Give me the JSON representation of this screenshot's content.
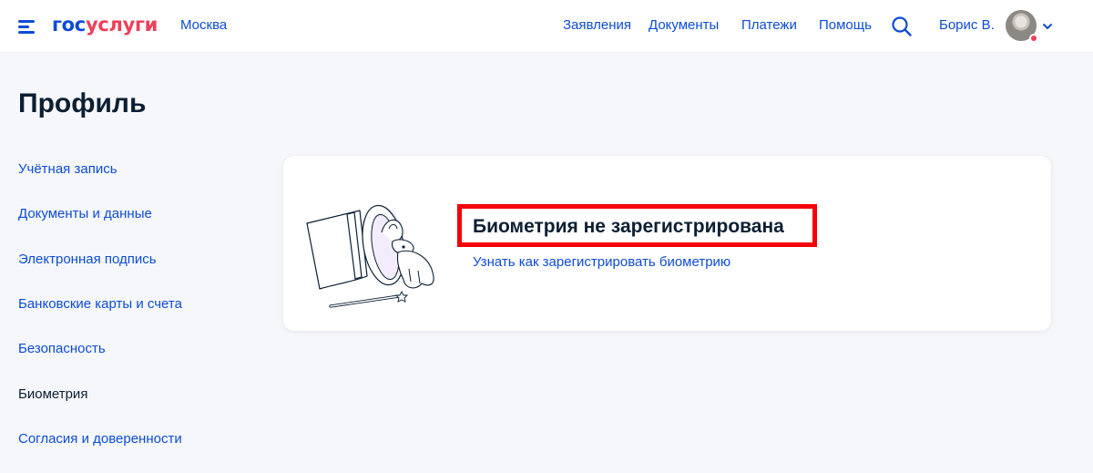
{
  "header": {
    "logo_part1": "гос",
    "logo_part2": "услуги",
    "city": "Москва",
    "nav": [
      {
        "label": "Заявления"
      },
      {
        "label": "Документы"
      },
      {
        "label": "Платежи"
      },
      {
        "label": "Помощь"
      }
    ],
    "user_name": "Борис В."
  },
  "page": {
    "title": "Профиль"
  },
  "sidebar": {
    "items": [
      {
        "label": "Учётная запись"
      },
      {
        "label": "Документы и данные"
      },
      {
        "label": "Электронная подпись"
      },
      {
        "label": "Банковские карты и счета"
      },
      {
        "label": "Безопасность"
      },
      {
        "label": "Биометрия",
        "active": true
      },
      {
        "label": "Согласия и доверенности"
      }
    ]
  },
  "biometry": {
    "title": "Биометрия не зарегистрирована",
    "link": "Узнать как зарегистрировать биометрию"
  },
  "colors": {
    "brand_blue": "#0d4cd3",
    "brand_red": "#ee3f58",
    "highlight": "#f50008",
    "text_dark": "#0b1f33",
    "background": "#f5f7fa"
  },
  "icons": {
    "menu": "burger-menu-icon",
    "search": "search-icon",
    "chevron": "chevron-down-icon",
    "illustration": "magic-hat-rabbit-illustration"
  }
}
